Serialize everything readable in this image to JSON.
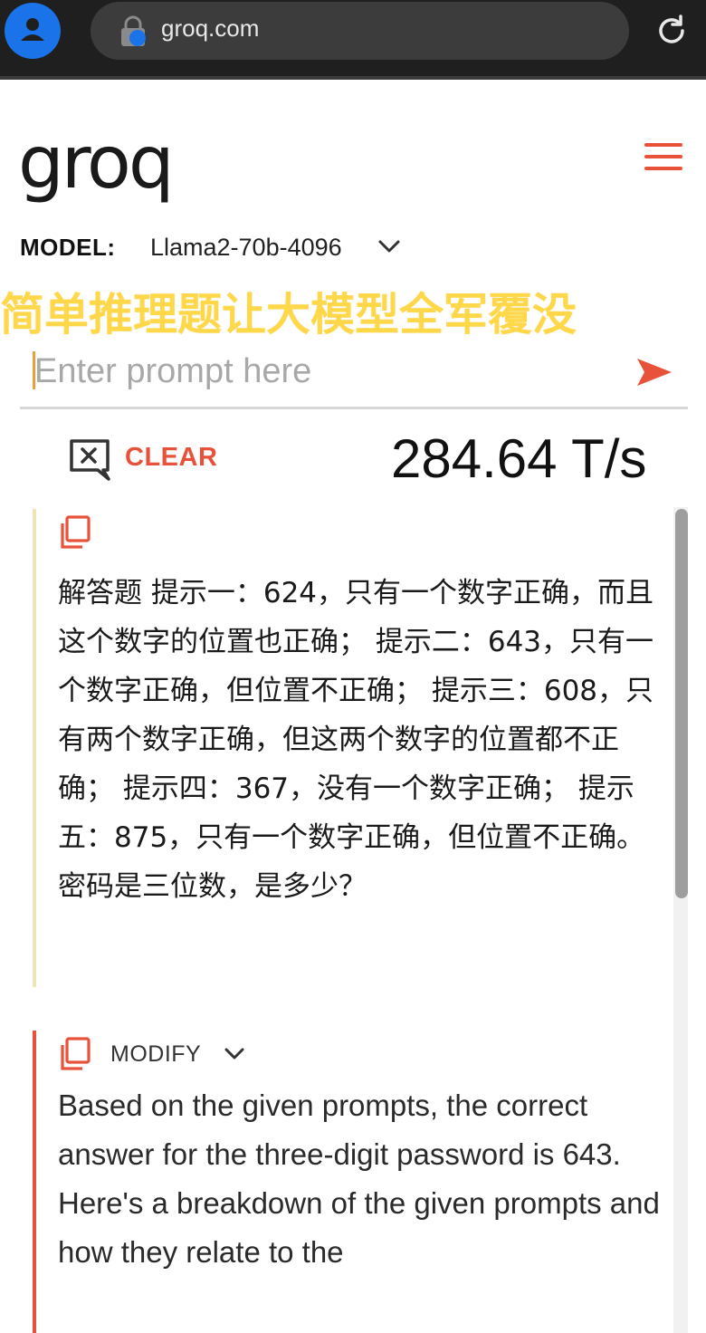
{
  "browser": {
    "url": "groq.com"
  },
  "header": {
    "logo_text": "groq",
    "model_label": "MODEL:",
    "model_value": "Llama2-70b-4096"
  },
  "overlay_title": "简单推理题让大模型全军覆没",
  "prompt": {
    "placeholder": "Enter prompt here"
  },
  "controls": {
    "clear_label": "CLEAR",
    "speed": "284.64 T/s"
  },
  "conversation": {
    "user_message": "解答题 提示一：624，只有一个数字正确，而且这个数字的位置也正确； 提示二：643，只有一个数字正确，但位置不正确； 提示三：608，只有两个数字正确，但这两个数字的位置都不正确； 提示四：367，没有一个数字正确； 提示五：875，只有一个数字正确，但位置不正确。密码是三位数，是多少？",
    "modify_label": "MODIFY",
    "ai_paragraph_1": "Based on the given prompts, the correct answer for the three-digit password is 643.",
    "ai_paragraph_2": "Here's a breakdown of the given prompts and how they relate to the"
  },
  "colors": {
    "accent": "#e8523a",
    "overlay_yellow": "#ffd84a",
    "chrome_bg": "#1f1f1f",
    "avatar_blue": "#1a73e8"
  }
}
